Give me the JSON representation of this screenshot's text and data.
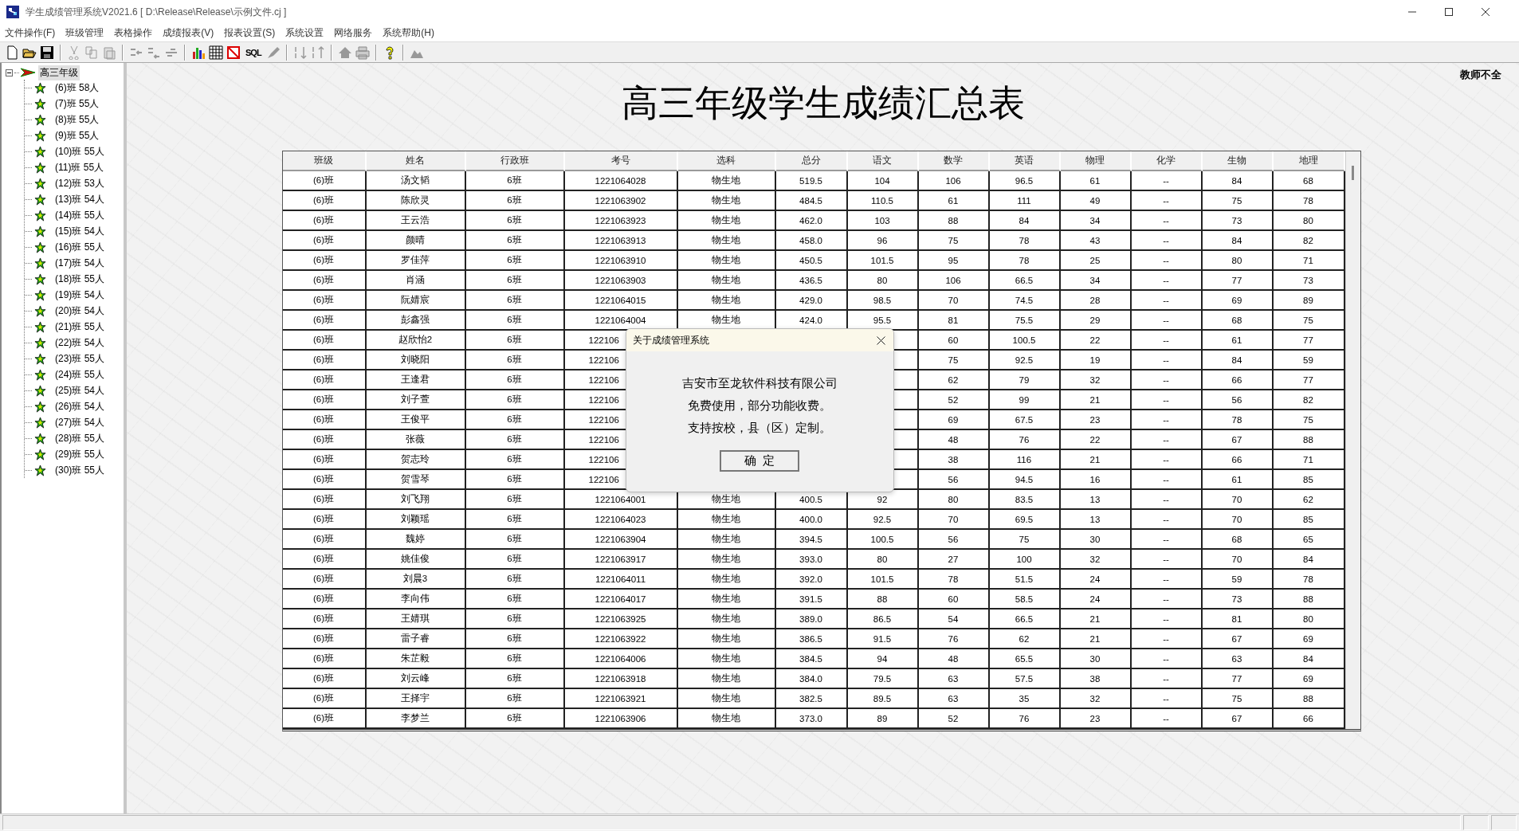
{
  "window": {
    "title": "学生成绩管理系统V2021.6 [ D:\\Release\\Release\\示例文件.cj ]"
  },
  "menu": [
    "文件操作(F)",
    "班级管理",
    "表格操作",
    "成绩报表(V)",
    "报表设置(S)",
    "系统设置",
    "网络服务",
    "系统帮助(H)"
  ],
  "toolbar": {
    "sql_label": "SQL"
  },
  "tree": {
    "label": "高三年级",
    "expanded": true,
    "selected": true,
    "children": [
      {
        "label": "(6)班 58人",
        "selected": false
      },
      {
        "label": "(7)班 55人",
        "selected": false
      },
      {
        "label": "(8)班 55人",
        "selected": false
      },
      {
        "label": "(9)班 55人",
        "selected": false
      },
      {
        "label": "(10)班 55人",
        "selected": false
      },
      {
        "label": "(11)班 55人",
        "selected": false
      },
      {
        "label": "(12)班 53人",
        "selected": false
      },
      {
        "label": "(13)班 54人",
        "selected": false
      },
      {
        "label": "(14)班 55人",
        "selected": false
      },
      {
        "label": "(15)班 54人",
        "selected": false
      },
      {
        "label": "(16)班 55人",
        "selected": false
      },
      {
        "label": "(17)班 54人",
        "selected": false
      },
      {
        "label": "(18)班 55人",
        "selected": false
      },
      {
        "label": "(19)班 54人",
        "selected": false
      },
      {
        "label": "(20)班 54人",
        "selected": false
      },
      {
        "label": "(21)班 55人",
        "selected": false
      },
      {
        "label": "(22)班 54人",
        "selected": false
      },
      {
        "label": "(23)班 55人",
        "selected": false
      },
      {
        "label": "(24)班 55人",
        "selected": false
      },
      {
        "label": "(25)班 54人",
        "selected": false
      },
      {
        "label": "(26)班 54人",
        "selected": false
      },
      {
        "label": "(27)班 54人",
        "selected": false
      },
      {
        "label": "(28)班 55人",
        "selected": false
      },
      {
        "label": "(29)班 55人",
        "selected": false
      },
      {
        "label": "(30)班 55人",
        "selected": false
      }
    ]
  },
  "report": {
    "title": "高三年级学生成绩汇总表",
    "note": "教师不全",
    "columns": [
      "班级",
      "姓名",
      "行政班",
      "考号",
      "选科",
      "总分",
      "语文",
      "数学",
      "英语",
      "物理",
      "化学",
      "生物",
      "地理"
    ],
    "rows": [
      [
        "(6)班",
        "汤文韬",
        "6班",
        "1221064028",
        "物生地",
        "519.5",
        "104",
        "106",
        "96.5",
        "61",
        "--",
        "84",
        "68"
      ],
      [
        "(6)班",
        "陈欣灵",
        "6班",
        "1221063902",
        "物生地",
        "484.5",
        "110.5",
        "61",
        "111",
        "49",
        "--",
        "75",
        "78"
      ],
      [
        "(6)班",
        "王云浩",
        "6班",
        "1221063923",
        "物生地",
        "462.0",
        "103",
        "88",
        "84",
        "34",
        "--",
        "73",
        "80"
      ],
      [
        "(6)班",
        "颜晴",
        "6班",
        "1221063913",
        "物生地",
        "458.0",
        "96",
        "75",
        "78",
        "43",
        "--",
        "84",
        "82"
      ],
      [
        "(6)班",
        "罗佳萍",
        "6班",
        "1221063910",
        "物生地",
        "450.5",
        "101.5",
        "95",
        "78",
        "25",
        "--",
        "80",
        "71"
      ],
      [
        "(6)班",
        "肖涵",
        "6班",
        "1221063903",
        "物生地",
        "436.5",
        "80",
        "106",
        "66.5",
        "34",
        "--",
        "77",
        "73"
      ],
      [
        "(6)班",
        "阮婧宸",
        "6班",
        "1221064015",
        "物生地",
        "429.0",
        "98.5",
        "70",
        "74.5",
        "28",
        "--",
        "69",
        "89"
      ],
      [
        "(6)班",
        "彭鑫强",
        "6班",
        "1221064004",
        "物生地",
        "424.0",
        "95.5",
        "81",
        "75.5",
        "29",
        "--",
        "68",
        "75"
      ],
      [
        "(6)班",
        "赵欣怡2",
        "6班",
        "122106",
        null,
        null,
        null,
        "60",
        "100.5",
        "22",
        "--",
        "61",
        "77"
      ],
      [
        "(6)班",
        "刘晓阳",
        "6班",
        "122106",
        null,
        null,
        null,
        "75",
        "92.5",
        "19",
        "--",
        "84",
        "59"
      ],
      [
        "(6)班",
        "王逢君",
        "6班",
        "122106",
        null,
        null,
        null,
        "62",
        "79",
        "32",
        "--",
        "66",
        "77"
      ],
      [
        "(6)班",
        "刘子萱",
        "6班",
        "122106",
        null,
        null,
        null,
        "52",
        "99",
        "21",
        "--",
        "56",
        "82"
      ],
      [
        "(6)班",
        "王俊平",
        "6班",
        "122106",
        null,
        null,
        null,
        "69",
        "67.5",
        "23",
        "--",
        "78",
        "75"
      ],
      [
        "(6)班",
        "张薇",
        "6班",
        "122106",
        null,
        null,
        null,
        "48",
        "76",
        "22",
        "--",
        "67",
        "88"
      ],
      [
        "(6)班",
        "贺志玲",
        "6班",
        "122106",
        null,
        null,
        null,
        "38",
        "116",
        "21",
        "--",
        "66",
        "71"
      ],
      [
        "(6)班",
        "贺雪琴",
        "6班",
        "122106",
        null,
        null,
        null,
        "56",
        "94.5",
        "16",
        "--",
        "61",
        "85"
      ],
      [
        "(6)班",
        "刘飞翔",
        "6班",
        "1221064001",
        "物生地",
        "400.5",
        "92",
        "80",
        "83.5",
        "13",
        "--",
        "70",
        "62"
      ],
      [
        "(6)班",
        "刘颖瑶",
        "6班",
        "1221064023",
        "物生地",
        "400.0",
        "92.5",
        "70",
        "69.5",
        "13",
        "--",
        "70",
        "85"
      ],
      [
        "(6)班",
        "魏婷",
        "6班",
        "1221063904",
        "物生地",
        "394.5",
        "100.5",
        "56",
        "75",
        "30",
        "--",
        "68",
        "65"
      ],
      [
        "(6)班",
        "姚佳俊",
        "6班",
        "1221063917",
        "物生地",
        "393.0",
        "80",
        "27",
        "100",
        "32",
        "--",
        "70",
        "84"
      ],
      [
        "(6)班",
        "刘晨3",
        "6班",
        "1221064011",
        "物生地",
        "392.0",
        "101.5",
        "78",
        "51.5",
        "24",
        "--",
        "59",
        "78"
      ],
      [
        "(6)班",
        "李向伟",
        "6班",
        "1221064017",
        "物生地",
        "391.5",
        "88",
        "60",
        "58.5",
        "24",
        "--",
        "73",
        "88"
      ],
      [
        "(6)班",
        "王婧琪",
        "6班",
        "1221063925",
        "物生地",
        "389.0",
        "86.5",
        "54",
        "66.5",
        "21",
        "--",
        "81",
        "80"
      ],
      [
        "(6)班",
        "雷子睿",
        "6班",
        "1221063922",
        "物生地",
        "386.5",
        "91.5",
        "76",
        "62",
        "21",
        "--",
        "67",
        "69"
      ],
      [
        "(6)班",
        "朱芷毅",
        "6班",
        "1221064006",
        "物生地",
        "384.5",
        "94",
        "48",
        "65.5",
        "30",
        "--",
        "63",
        "84"
      ],
      [
        "(6)班",
        "刘云峰",
        "6班",
        "1221063918",
        "物生地",
        "384.0",
        "79.5",
        "63",
        "57.5",
        "38",
        "--",
        "77",
        "69"
      ],
      [
        "(6)班",
        "王择宇",
        "6班",
        "1221063921",
        "物生地",
        "382.5",
        "89.5",
        "63",
        "35",
        "32",
        "--",
        "75",
        "88"
      ],
      [
        "(6)班",
        "李梦兰",
        "6班",
        "1221063906",
        "物生地",
        "373.0",
        "89",
        "52",
        "76",
        "23",
        "--",
        "67",
        "66"
      ]
    ]
  },
  "dialog": {
    "title": "关于成绩管理系统",
    "lines": [
      "吉安市至龙软件科技有限公司",
      "免费使用，部分功能收费。",
      "支持按校，县（区）定制。"
    ],
    "button": "确  定"
  }
}
